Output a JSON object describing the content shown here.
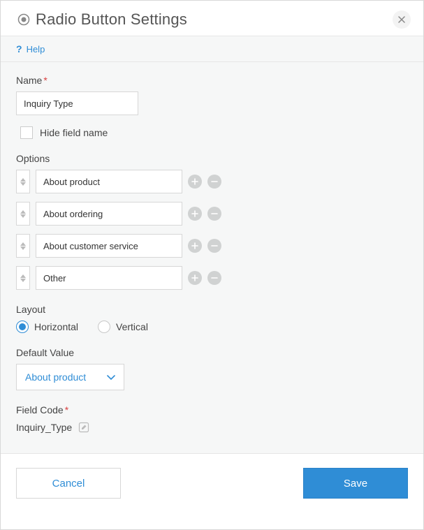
{
  "header": {
    "title": "Radio Button Settings"
  },
  "help": {
    "label": "Help"
  },
  "name": {
    "label": "Name",
    "value": "Inquiry Type",
    "hide_checkbox_label": "Hide field name"
  },
  "options": {
    "label": "Options",
    "items": [
      {
        "value": "About product"
      },
      {
        "value": "About ordering"
      },
      {
        "value": "About customer service"
      },
      {
        "value": "Other"
      }
    ]
  },
  "layout": {
    "label": "Layout",
    "choices": {
      "horizontal": "Horizontal",
      "vertical": "Vertical"
    },
    "selected": "horizontal"
  },
  "default_value": {
    "label": "Default Value",
    "selected": "About product"
  },
  "field_code": {
    "label": "Field Code",
    "value": "Inquiry_Type"
  },
  "footer": {
    "cancel": "Cancel",
    "save": "Save"
  }
}
